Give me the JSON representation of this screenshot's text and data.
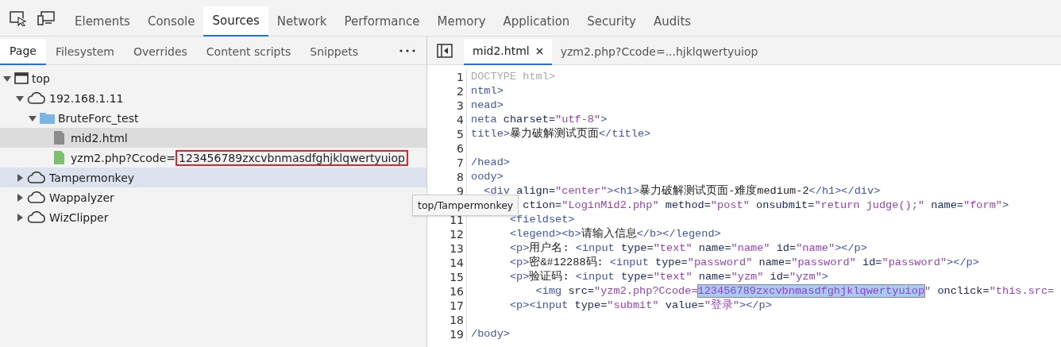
{
  "toolbar": {
    "tabs": [
      {
        "label": "Elements",
        "selected": false
      },
      {
        "label": "Console",
        "selected": false
      },
      {
        "label": "Sources",
        "selected": true
      },
      {
        "label": "Network",
        "selected": false
      },
      {
        "label": "Performance",
        "selected": false
      },
      {
        "label": "Memory",
        "selected": false
      },
      {
        "label": "Application",
        "selected": false
      },
      {
        "label": "Security",
        "selected": false
      },
      {
        "label": "Audits",
        "selected": false
      }
    ]
  },
  "navigator": {
    "tabs": [
      {
        "label": "Page",
        "selected": true
      },
      {
        "label": "Filesystem",
        "selected": false
      },
      {
        "label": "Overrides",
        "selected": false
      },
      {
        "label": "Content scripts",
        "selected": false
      },
      {
        "label": "Snippets",
        "selected": false
      }
    ],
    "tree": [
      {
        "kind": "frame",
        "name": "top",
        "expanded": true,
        "selected": false,
        "hovered": false,
        "children": [
          {
            "kind": "cloud",
            "name": "192.168.1.11",
            "expanded": true,
            "selected": false,
            "hovered": false,
            "children": [
              {
                "kind": "folder",
                "name": "BruteForc_test",
                "expanded": true,
                "selected": false,
                "hovered": false,
                "children": [
                  {
                    "kind": "file",
                    "color": "#8c8c8c",
                    "name": "mid2.html",
                    "selected": true,
                    "hovered": false
                  },
                  {
                    "kind": "file",
                    "color": "#7dbf6e",
                    "name": "yzm2.php?Ccode=",
                    "boxed_part": "123456789zxcvbnmasdfghjklqwertyuiop",
                    "selected": false,
                    "hovered": false
                  }
                ]
              }
            ]
          },
          {
            "kind": "cloud",
            "name": "Tampermonkey",
            "expanded": false,
            "selected": false,
            "hovered": true
          },
          {
            "kind": "cloud",
            "name": "Wappalyzer",
            "expanded": false,
            "selected": false,
            "hovered": false
          },
          {
            "kind": "cloud",
            "name": "WizClipper",
            "expanded": false,
            "selected": false,
            "hovered": false
          }
        ]
      }
    ],
    "tooltip": "top/Tampermonkey"
  },
  "editor": {
    "tabs": [
      {
        "label": "mid2.html",
        "selected": true,
        "closable": true
      },
      {
        "label": "yzm2.php?Ccode=...hjklqwertyuiop",
        "selected": false,
        "closable": false
      }
    ],
    "lines": [
      {
        "number": "1",
        "tokens": [
          {
            "kind": "doctype",
            "text": "DOCTYPE html>"
          }
        ]
      },
      {
        "number": "2",
        "tokens": [
          {
            "kind": "tag",
            "text": "ntml>"
          }
        ]
      },
      {
        "number": "3",
        "tokens": [
          {
            "kind": "tag",
            "text": "nead>"
          }
        ]
      },
      {
        "number": "4",
        "tokens": [
          {
            "kind": "tag",
            "text": "neta"
          },
          {
            "kind": "attr",
            "text": " charset="
          },
          {
            "kind": "value",
            "text": "\"utf-8\""
          },
          {
            "kind": "tag",
            "text": ">"
          }
        ]
      },
      {
        "number": "5",
        "tokens": [
          {
            "kind": "tag",
            "text": "title>"
          },
          {
            "kind": "text",
            "text": "暴力破解测试页面"
          },
          {
            "kind": "tag",
            "text": "</title>"
          }
        ]
      },
      {
        "number": "6"
      },
      {
        "number": "7",
        "tokens": [
          {
            "kind": "tag",
            "text": "/head>"
          }
        ]
      },
      {
        "number": "8",
        "tokens": [
          {
            "kind": "tag",
            "text": "oody>"
          }
        ]
      },
      {
        "number": "9",
        "tokens": [
          {
            "kind": "tag",
            "text": "  <div"
          },
          {
            "kind": "attr",
            "text": " align="
          },
          {
            "kind": "value",
            "text": "\"center\""
          },
          {
            "kind": "tag",
            "text": "><h1>"
          },
          {
            "kind": "text",
            "text": "暴力破解测试页面-难度medium-2"
          },
          {
            "kind": "tag",
            "text": "</h1></div>"
          }
        ]
      },
      {
        "tokens": [
          {
            "kind": "attr",
            "text": "        ction="
          },
          {
            "kind": "value",
            "text": "\"LoginMid2.php\""
          },
          {
            "kind": "attr",
            "text": " method="
          },
          {
            "kind": "value",
            "text": "\"post\""
          },
          {
            "kind": "attr",
            "text": " onsubmit="
          },
          {
            "kind": "value",
            "text": "\"return judge();\""
          },
          {
            "kind": "attr",
            "text": " name="
          },
          {
            "kind": "value",
            "text": "\"form\""
          },
          {
            "kind": "tag",
            "text": ">"
          }
        ]
      },
      {
        "number": "11",
        "tokens": [
          {
            "kind": "tag",
            "text": "      <fieldset>"
          }
        ]
      },
      {
        "number": "12",
        "tokens": [
          {
            "kind": "tag",
            "text": "      <legend><b>"
          },
          {
            "kind": "text",
            "text": "请输入信息"
          },
          {
            "kind": "tag",
            "text": "</b></legend>"
          }
        ]
      },
      {
        "number": "13",
        "tokens": [
          {
            "kind": "tag",
            "text": "      <p>"
          },
          {
            "kind": "text",
            "text": "用户名: "
          },
          {
            "kind": "tag",
            "text": "<input"
          },
          {
            "kind": "attr",
            "text": " type="
          },
          {
            "kind": "value",
            "text": "\"text\""
          },
          {
            "kind": "attr",
            "text": " name="
          },
          {
            "kind": "value",
            "text": "\"name\""
          },
          {
            "kind": "attr",
            "text": " id="
          },
          {
            "kind": "value",
            "text": "\"name\""
          },
          {
            "kind": "tag",
            "text": "></p>"
          }
        ]
      },
      {
        "number": "14",
        "tokens": [
          {
            "kind": "tag",
            "text": "      <p>"
          },
          {
            "kind": "text",
            "text": "密&#12288码: "
          },
          {
            "kind": "tag",
            "text": "<input"
          },
          {
            "kind": "attr",
            "text": " type="
          },
          {
            "kind": "value",
            "text": "\"password\""
          },
          {
            "kind": "attr",
            "text": " name="
          },
          {
            "kind": "value",
            "text": "\"password\""
          },
          {
            "kind": "attr",
            "text": " id="
          },
          {
            "kind": "value",
            "text": "\"password\""
          },
          {
            "kind": "tag",
            "text": "></p>"
          }
        ]
      },
      {
        "number": "15",
        "tokens": [
          {
            "kind": "tag",
            "text": "      <p>"
          },
          {
            "kind": "text",
            "text": "验证码: "
          },
          {
            "kind": "tag",
            "text": "<input"
          },
          {
            "kind": "attr",
            "text": " type="
          },
          {
            "kind": "value",
            "text": "\"text\""
          },
          {
            "kind": "attr",
            "text": " name="
          },
          {
            "kind": "value",
            "text": "\"yzm\""
          },
          {
            "kind": "attr",
            "text": " id="
          },
          {
            "kind": "value",
            "text": "\"yzm\""
          },
          {
            "kind": "tag",
            "text": ">"
          }
        ]
      },
      {
        "number": "16",
        "tokens": [
          {
            "kind": "tag",
            "text": "          <img"
          },
          {
            "kind": "attr",
            "text": " src="
          },
          {
            "kind": "value",
            "text": "\"yzm2.php?Ccode="
          },
          {
            "kind": "selected",
            "text": "123456789zxcvbnmasdfghjklqwertyuiop"
          },
          {
            "kind": "value",
            "text": "\""
          },
          {
            "kind": "attr",
            "text": " onclick="
          },
          {
            "kind": "value",
            "text": "\"this.src="
          }
        ]
      },
      {
        "number": "17",
        "tokens": [
          {
            "kind": "tag",
            "text": "      <p><input"
          },
          {
            "kind": "attr",
            "text": " type="
          },
          {
            "kind": "value",
            "text": "\"submit\""
          },
          {
            "kind": "attr",
            "text": " value="
          },
          {
            "kind": "value",
            "text": "\"登录\""
          },
          {
            "kind": "tag",
            "text": "></p>"
          }
        ]
      },
      {
        "number": "18"
      },
      {
        "number": "19",
        "tokens": [
          {
            "kind": "tag",
            "text": "/body>"
          }
        ]
      }
    ]
  }
}
